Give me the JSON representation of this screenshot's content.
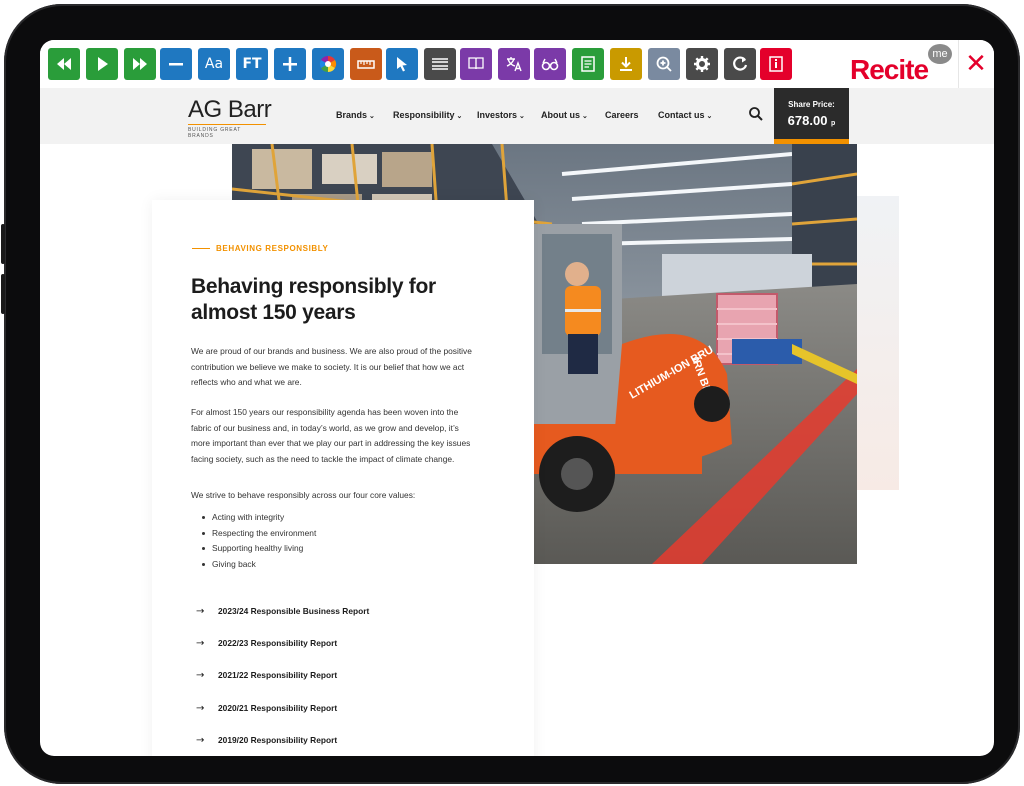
{
  "toolbar": {
    "buttons": [
      {
        "icon": "rewind-icon",
        "color": "#2a9d3a"
      },
      {
        "icon": "play-icon",
        "color": "#2a9d3a"
      },
      {
        "icon": "fast-forward-icon",
        "color": "#2a9d3a"
      },
      {
        "icon": "minus-icon",
        "color": "#1f78c1"
      },
      {
        "icon": "font-size-icon",
        "label": "Aa",
        "color": "#1f78c1"
      },
      {
        "icon": "font-type-icon",
        "label": "FT",
        "color": "#1f78c1"
      },
      {
        "icon": "plus-icon",
        "color": "#1f78c1"
      },
      {
        "icon": "color-wheel-icon",
        "color": "#1f78c1"
      },
      {
        "icon": "ruler-icon",
        "color": "#c95a1a"
      },
      {
        "icon": "cursor-icon",
        "color": "#1f78c1"
      },
      {
        "icon": "text-mask-icon",
        "color": "#4a4a4a"
      },
      {
        "icon": "dictionary-icon",
        "color": "#7b3aa8"
      },
      {
        "icon": "translate-icon",
        "color": "#7b3aa8"
      },
      {
        "icon": "glasses-icon",
        "color": "#7b3aa8"
      },
      {
        "icon": "reader-icon",
        "color": "#2a9d3a"
      },
      {
        "icon": "download-icon",
        "color": "#c99a00"
      },
      {
        "icon": "zoom-icon",
        "color": "#7a8aa0"
      },
      {
        "icon": "settings-icon",
        "color": "#4a4a4a"
      },
      {
        "icon": "reset-icon",
        "color": "#4a4a4a"
      },
      {
        "icon": "info-icon",
        "color": "#e4002b"
      }
    ],
    "brand": "Recite",
    "brand_badge": "me",
    "close_glyph": "✕"
  },
  "header": {
    "logo_name": "AG Barr",
    "logo_tagline": "BUILDING GREAT BRANDS",
    "nav": [
      "Brands",
      "Responsibility",
      "Investors",
      "About us",
      "Careers",
      "Contact us"
    ],
    "nav_has_caret": [
      true,
      true,
      true,
      true,
      false,
      true
    ],
    "share_label": "Share Price:",
    "share_value": "678.00",
    "share_unit": "p"
  },
  "content": {
    "eyebrow": "BEHAVING RESPONSIBLY",
    "heading": "Behaving responsibly for almost 150 years",
    "para1": "We are proud of our brands and business.  We are also proud of the positive contribution we believe we make to society.  It is our belief that how we act reflects who and what we are.",
    "para2": "For almost 150 years our responsibility agenda has been woven into the fabric of our business and, in today’s world, as we grow and develop, it’s more important than ever that we play our part in addressing the key issues facing society, such as the need to tackle the impact of climate change.",
    "para3": "We strive to behave responsibly across our four core values:",
    "values": [
      "Acting with integrity",
      "Respecting the environment",
      "Supporting healthy living",
      "Giving back"
    ],
    "reports": [
      "2023/24 Responsible Business Report",
      "2022/23 Responsibility Report",
      "2021/22 Responsibility Report",
      "2020/21 Responsibility Report",
      "2019/20 Responsibility Report"
    ],
    "forklift_text": "LITHIUM-ION BRU",
    "forklift_side": "IRN BRU"
  },
  "colors": {
    "accent": "#f29100",
    "recite_red": "#e4002b"
  }
}
